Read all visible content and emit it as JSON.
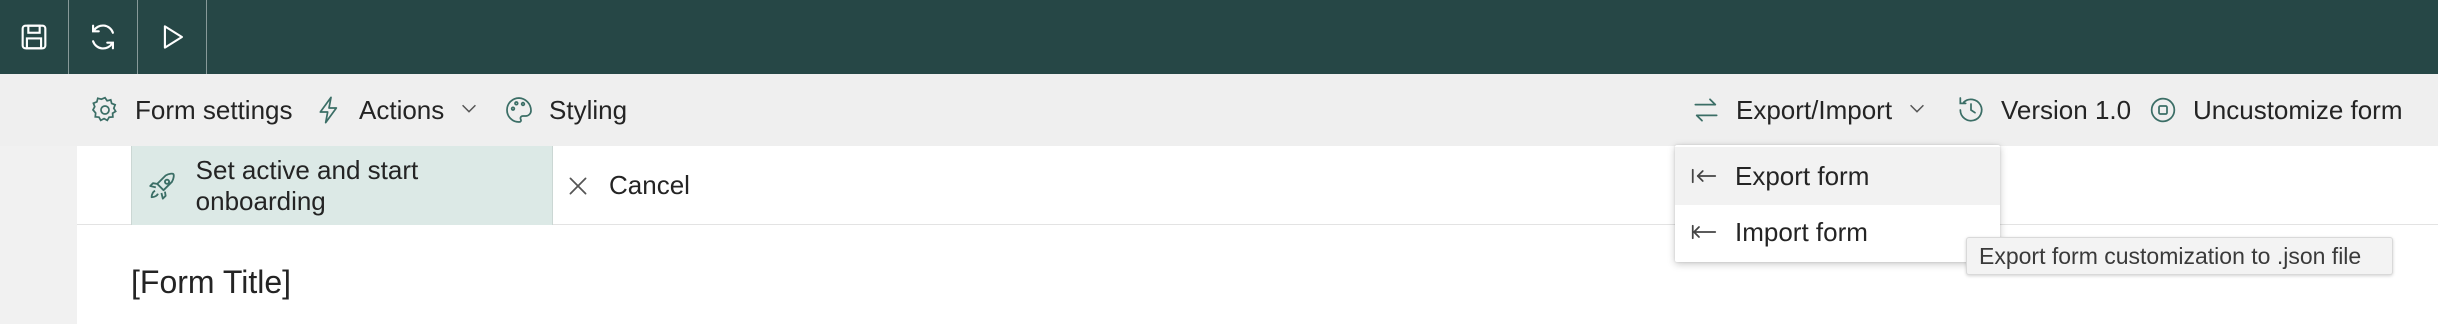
{
  "toolbar": {
    "save_icon": "save-icon",
    "refresh_icon": "refresh-icon",
    "preview_icon": "play-icon"
  },
  "command_bar": {
    "form_settings": "Form settings",
    "actions": "Actions",
    "styling": "Styling",
    "export_import": "Export/Import",
    "version": "Version 1.0",
    "uncustomize": "Uncustomize form"
  },
  "form_bar": {
    "activate": "Set active and start onboarding",
    "cancel": "Cancel"
  },
  "form": {
    "title": "[Form Title]"
  },
  "export_import_menu": {
    "items": [
      {
        "label": "Export form",
        "icon": "export-icon"
      },
      {
        "label": "Import form",
        "icon": "import-icon"
      }
    ]
  },
  "tooltip": {
    "text": "Export form customization to .json file"
  },
  "colors": {
    "topbar": "#264746",
    "accent_button": "#dce9e6",
    "accent_icon": "#3b6e66"
  }
}
